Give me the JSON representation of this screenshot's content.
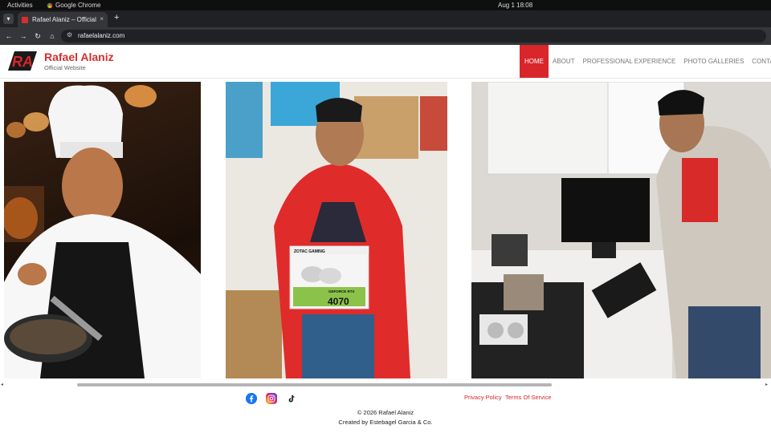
{
  "os": {
    "activities": "Activities",
    "app_name": "Google Chrome",
    "clock": "Aug 1  18:08"
  },
  "browser": {
    "tab_title": "Rafael Alaniz – Official W",
    "tab_close": "×",
    "new_tab": "+",
    "url": "rafaelalaniz.com",
    "nav": {
      "back": "←",
      "forward": "→",
      "reload": "↻",
      "home": "⌂",
      "tab_search": "▾",
      "site_info": "⚙"
    }
  },
  "site": {
    "title": "Rafael Alaniz",
    "subtitle": "Official Website",
    "logo_text": "RA",
    "brand_color": "#d9262b",
    "menu": [
      {
        "label": "HOME",
        "active": true
      },
      {
        "label": "ABOUT",
        "active": false
      },
      {
        "label": "PROFESSIONAL EXPERIENCE",
        "active": false
      },
      {
        "label": "PHOTO GALLERIES",
        "active": false
      },
      {
        "label": "CONTACT",
        "active": false
      }
    ]
  },
  "gallery": {
    "photos": [
      {
        "name": "chef-photo"
      },
      {
        "name": "gpu-box-photo",
        "box_brand": "ZOTAC GAMING",
        "box_model": "GEFORCE RTX",
        "box_number": "4070"
      },
      {
        "name": "pc-build-photo"
      }
    ]
  },
  "scrollbar": {
    "left_arrow": "◂",
    "right_arrow": "▸"
  },
  "footer": {
    "social": [
      "facebook-icon",
      "instagram-icon",
      "tiktok-icon"
    ],
    "links": [
      "Privacy Policy",
      "Terms Of Service"
    ],
    "copyright": "© 2026 Rafael Alaniz",
    "credit": "Created by Estebagel Garcia & Co."
  }
}
